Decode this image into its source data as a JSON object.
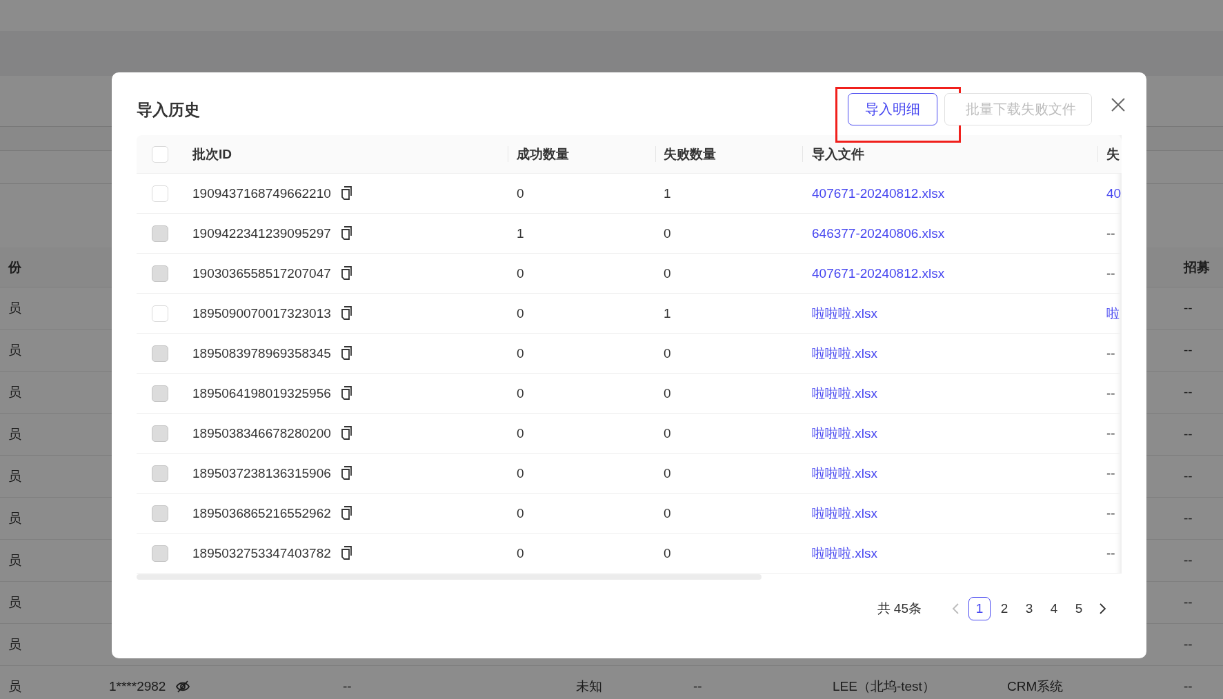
{
  "background_table": {
    "header": {
      "column_1": "份",
      "column_8": "招募"
    },
    "rows": [
      {
        "column_1": "员",
        "column_8": "--"
      },
      {
        "column_1": "员",
        "column_8": "--"
      },
      {
        "column_1": "员",
        "column_8": "--"
      },
      {
        "column_1": "员",
        "column_8": "--"
      },
      {
        "column_1": "员",
        "column_8": "--"
      },
      {
        "column_1": "员",
        "column_8": "--"
      },
      {
        "column_1": "员",
        "column_8": "--"
      },
      {
        "column_1": "员",
        "column_8": "--"
      },
      {
        "column_1": "员",
        "column_8": "--"
      },
      {
        "column_1": "员",
        "column_2": "1****2982",
        "column_3": "--",
        "column_4": "未知",
        "column_5": "--",
        "column_6": "LEE（北坞-test）",
        "column_7": "CRM系统",
        "column_8": "--"
      }
    ]
  },
  "dialog": {
    "title": "导入历史",
    "buttons": [
      {
        "label": "导入明细",
        "kind": "primary",
        "disabled": false,
        "highlighted": true
      },
      {
        "label": "批量下载失败文件",
        "kind": "default",
        "disabled": true,
        "highlighted": false
      }
    ],
    "table": {
      "select_all": {
        "checked": false,
        "disabled": false
      },
      "columns": [
        "批次ID",
        "成功数量",
        "失败数量",
        "导入文件",
        "失"
      ],
      "rows": [
        {
          "checked": false,
          "disabled": false,
          "batch_id": "1909437168749662210",
          "success_count": "0",
          "failure_count": "1",
          "import_file": "407671-20240812.xlsx",
          "column_5": {
            "text": "40",
            "kind": "link"
          }
        },
        {
          "checked": false,
          "disabled": true,
          "batch_id": "1909422341239095297",
          "success_count": "1",
          "failure_count": "0",
          "import_file": "646377-20240806.xlsx",
          "column_5": {
            "text": "--",
            "kind": "text"
          }
        },
        {
          "checked": false,
          "disabled": true,
          "batch_id": "1903036558517207047",
          "success_count": "0",
          "failure_count": "0",
          "import_file": "407671-20240812.xlsx",
          "column_5": {
            "text": "--",
            "kind": "text"
          }
        },
        {
          "checked": false,
          "disabled": false,
          "batch_id": "1895090070017323013",
          "success_count": "0",
          "failure_count": "1",
          "import_file": "啦啦啦.xlsx",
          "column_5": {
            "text": "啦",
            "kind": "link"
          }
        },
        {
          "checked": false,
          "disabled": true,
          "batch_id": "1895083978969358345",
          "success_count": "0",
          "failure_count": "0",
          "import_file": "啦啦啦.xlsx",
          "column_5": {
            "text": "--",
            "kind": "text"
          }
        },
        {
          "checked": false,
          "disabled": true,
          "batch_id": "1895064198019325956",
          "success_count": "0",
          "failure_count": "0",
          "import_file": "啦啦啦.xlsx",
          "column_5": {
            "text": "--",
            "kind": "text"
          }
        },
        {
          "checked": false,
          "disabled": true,
          "batch_id": "1895038346678280200",
          "success_count": "0",
          "failure_count": "0",
          "import_file": "啦啦啦.xlsx",
          "column_5": {
            "text": "--",
            "kind": "text"
          }
        },
        {
          "checked": false,
          "disabled": true,
          "batch_id": "1895037238136315906",
          "success_count": "0",
          "failure_count": "0",
          "import_file": "啦啦啦.xlsx",
          "column_5": {
            "text": "--",
            "kind": "text"
          }
        },
        {
          "checked": false,
          "disabled": true,
          "batch_id": "1895036865216552962",
          "success_count": "0",
          "failure_count": "0",
          "import_file": "啦啦啦.xlsx",
          "column_5": {
            "text": "--",
            "kind": "text"
          }
        },
        {
          "checked": false,
          "disabled": true,
          "batch_id": "1895032753347403782",
          "success_count": "0",
          "failure_count": "0",
          "import_file": "啦啦啦.xlsx",
          "column_5": {
            "text": "--",
            "kind": "text"
          }
        }
      ]
    },
    "pagination": {
      "total": "共 45条",
      "prev_disabled": true,
      "next_disabled": false,
      "pages": [
        {
          "label": "1",
          "selected": true
        },
        {
          "label": "2",
          "selected": false
        },
        {
          "label": "3",
          "selected": false
        },
        {
          "label": "4",
          "selected": false
        },
        {
          "label": "5",
          "selected": false
        }
      ]
    }
  }
}
